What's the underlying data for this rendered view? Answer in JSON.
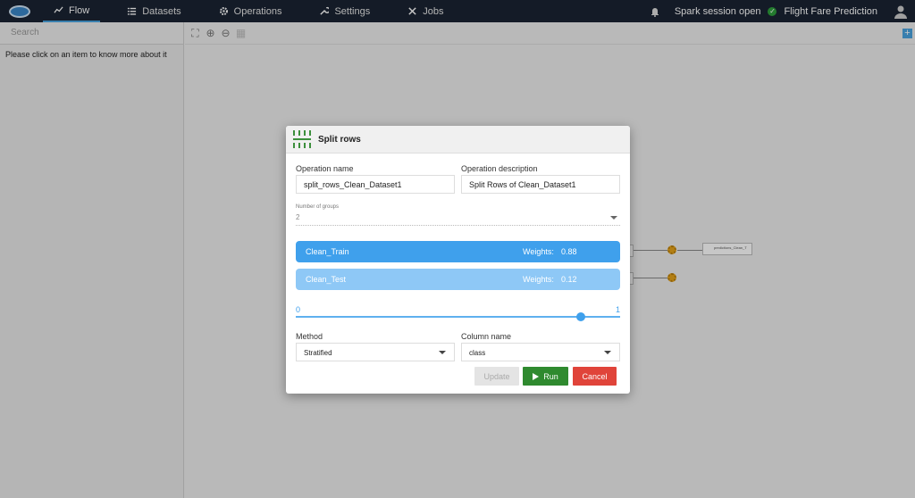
{
  "nav": {
    "items": [
      {
        "label": "Flow",
        "icon": "chart-line-icon",
        "active": true
      },
      {
        "label": "Datasets",
        "icon": "list-icon"
      },
      {
        "label": "Operations",
        "icon": "gear-icon"
      },
      {
        "label": "Settings",
        "icon": "wrench-icon"
      },
      {
        "label": "Jobs",
        "icon": "tools-icon"
      }
    ],
    "session_status": "Spark session open",
    "project_name": "Flight Fare Prediction"
  },
  "sidebar": {
    "search_placeholder": "Search",
    "message": "Please click on an item to know more about it"
  },
  "canvas": {
    "node_label": "predictions_Clean_T"
  },
  "modal": {
    "title": "Split rows",
    "operation_name_label": "Operation name",
    "operation_name_value": "split_rows_Clean_Dataset1",
    "operation_description_label": "Operation description",
    "operation_description_value": "Split Rows of Clean_Dataset1",
    "groups_label": "Number of groups",
    "groups_value": "2",
    "groups": [
      {
        "name": "Clean_Train",
        "weights_label": "Weights:",
        "weight": "0.88"
      },
      {
        "name": "Clean_Test",
        "weights_label": "Weights:",
        "weight": "0.12"
      }
    ],
    "slider": {
      "min": "0",
      "max": "1",
      "value": 0.88
    },
    "method_label": "Method",
    "method_value": "Stratified",
    "column_label": "Column name",
    "column_value": "class",
    "buttons": {
      "update": "Update",
      "run": "Run",
      "cancel": "Cancel"
    }
  },
  "colors": {
    "accent": "#3fa0ec",
    "run": "#2f8a2f",
    "cancel": "#e0443a",
    "topbar": "#1a2332"
  }
}
